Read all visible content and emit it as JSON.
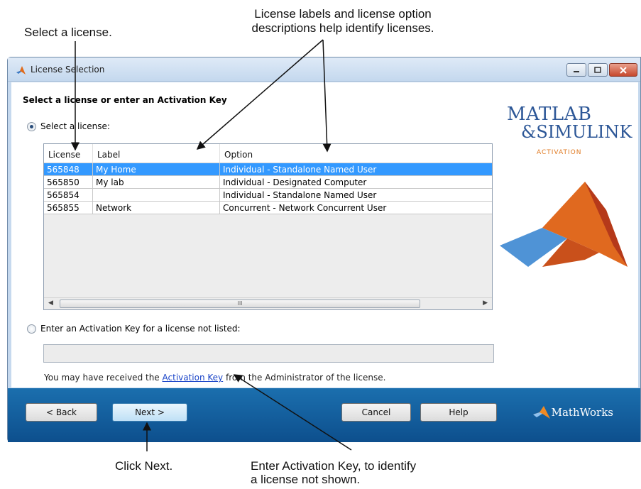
{
  "callouts": {
    "select_license": "Select a license.",
    "labels_line1": "License labels and license option",
    "labels_line2": "descriptions help identify licenses.",
    "click_next": "Click Next.",
    "key_line1": "Enter Activation Key, to identify",
    "key_line2": "a license not shown."
  },
  "window": {
    "title": "License Selection",
    "heading": "Select a license or enter an Activation Key",
    "radio_select_label": "Select a license:",
    "radio_key_label": "Enter an Activation Key for a license not listed:",
    "key_input_value": "",
    "note_before": "You may have received the ",
    "note_link": "Activation Key",
    "note_after": " from the Administrator of the license."
  },
  "table": {
    "columns": [
      "License",
      "Label",
      "Option"
    ],
    "rows": [
      {
        "license": "565848",
        "label": "My Home",
        "option": "Individual - Standalone Named User",
        "selected": true
      },
      {
        "license": "565850",
        "label": "My lab",
        "option": "Individual - Designated Computer",
        "selected": false
      },
      {
        "license": "565854",
        "label": "",
        "option": "Individual - Standalone Named User",
        "selected": false
      },
      {
        "license": "565855",
        "label": "Network",
        "option": "Concurrent - Network Concurrent User",
        "selected": false
      }
    ],
    "scroll_grip": "III"
  },
  "branding": {
    "matlab": "MATLAB",
    "simulink": "&SIMULINK",
    "activation": "ACTIVATION",
    "mathworks": "MathWorks"
  },
  "buttons": {
    "back": "< Back",
    "next": "Next >",
    "cancel": "Cancel",
    "help": "Help"
  },
  "colors": {
    "selection": "#3399ff",
    "footer": "#1b6fae",
    "brand_blue": "#2d5797",
    "brand_orange": "#e07a22"
  }
}
